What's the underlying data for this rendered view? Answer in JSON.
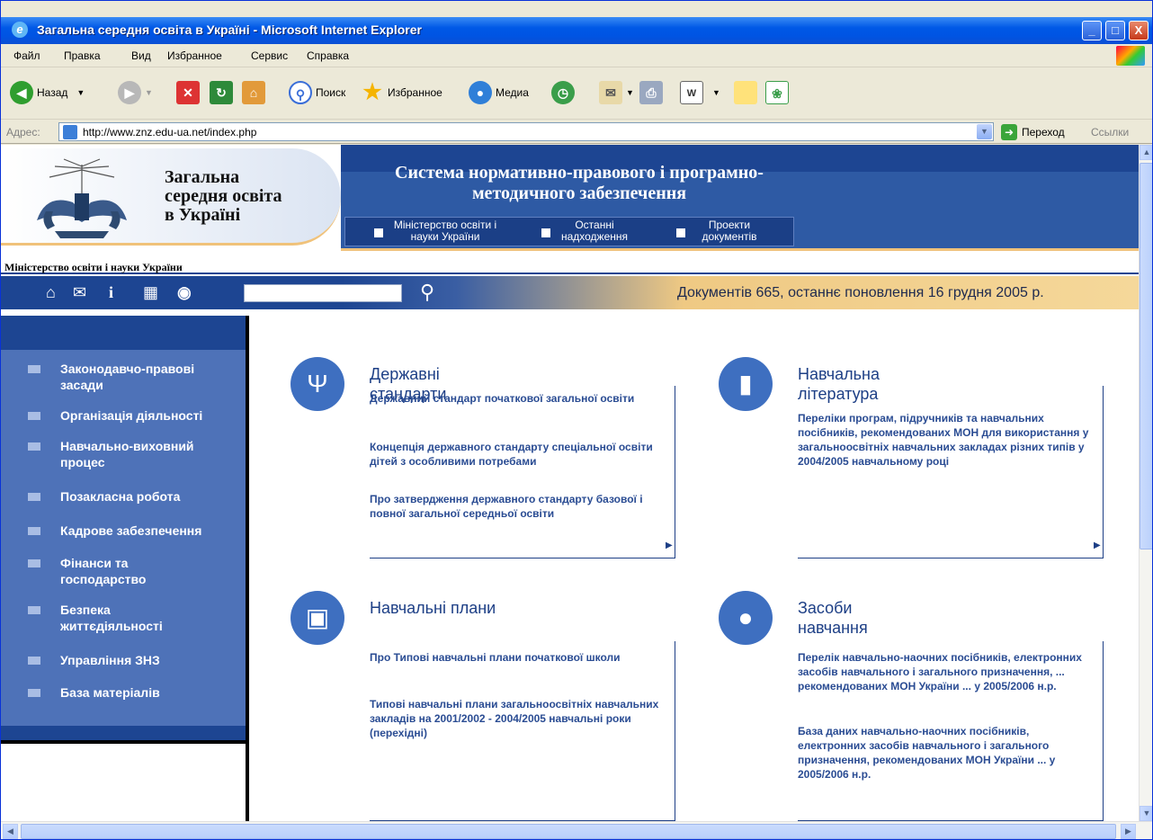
{
  "window": {
    "title": "Загальна середня освіта в Україні - Microsoft Internet Explorer",
    "minimize": "_",
    "maximize": "□",
    "close": "X"
  },
  "menu": [
    "Файл",
    "Правка",
    "Вид",
    "Избранное",
    "Сервис",
    "Справка"
  ],
  "toolbar": {
    "back": "Назад",
    "search": "Поиск",
    "favorites": "Избранное",
    "media": "Медиа"
  },
  "address": {
    "label": "Адрес:",
    "url": "http://www.znz.edu-ua.net/index.php",
    "go": "Переход",
    "links": "Ссылки"
  },
  "header": {
    "site_name": [
      "Загальна",
      "середня освіта",
      "в Україні"
    ],
    "banner_title": "Система нормативно-правового і програмно-методичного забезпечення",
    "top_nav": [
      {
        "label": "Міністерство освіти і науки України"
      },
      {
        "label": "Останні надходження"
      },
      {
        "label": "Проекти документів"
      }
    ],
    "ministry": "Міністерство освіти і науки України"
  },
  "navbar": {
    "icons": [
      "home-icon",
      "mail-icon",
      "info-icon",
      "sitemap-icon",
      "help-icon"
    ],
    "search_value": "",
    "doc_count": "Документів 665, останнє поновлення 16 грудня 2005 р."
  },
  "sidebar": {
    "items": [
      "Законодавчо-правові засади",
      "Організація діяльності",
      "Навчально-виховний процес",
      "Позакласна робота",
      "Кадрове забезпечення",
      "Фінанси та господарство",
      "Безпека життєдіяльності",
      "Управління ЗНЗ",
      "База матеріалів"
    ]
  },
  "sections": {
    "standards": {
      "title": "Державні стандарти",
      "links": [
        "Державний стандарт початкової загальної освіти",
        "Концепція державного стандарту спеціальної освіти дітей з особливими потребами",
        "Про затвердження державного стандарту базової і повної загальної середньої освіти"
      ]
    },
    "literature": {
      "title": "Навчальна література",
      "links": [
        "Переліки програм, підручників та навчальних посібників, рекомендованих МОН для використання у загальноосвітніх навчальних закладах різних типів у 2004/2005 навчальному році"
      ]
    },
    "plans": {
      "title": "Навчальні плани",
      "links": [
        "Про Типові навчальні плани початкової школи",
        "Типові навчальні плани загальноосвітніх навчальних закладів на 2001/2002 - 2004/2005 навчальні роки (перехідні)"
      ]
    },
    "tools": {
      "title": "Засоби навчання",
      "links": [
        "Перелік навчально-наочних посібників, електронних засобів навчального і загального призначення, ... рекомендованих МОН України ... у 2005/2006 н.р.",
        "База даних навчально-наочних посібників, електронних засобів навчального і загального призначення, рекомендованих МОН України ... у 2005/2006 н.р."
      ]
    }
  },
  "colors": {
    "dark_blue": "#1d4592",
    "sidebar_blue": "#4e72b8",
    "gold": "#f0c27a",
    "link_blue": "#2a4c93"
  }
}
